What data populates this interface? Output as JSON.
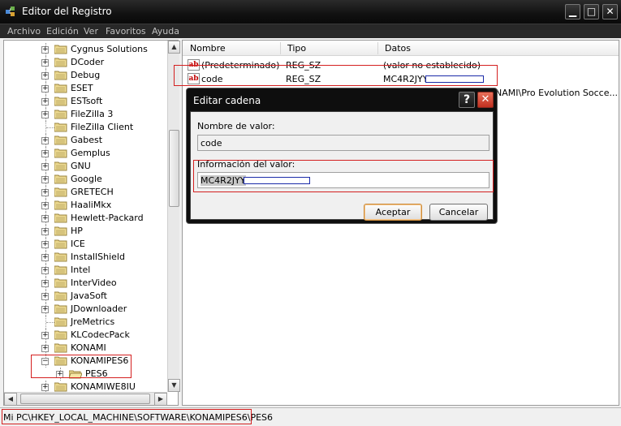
{
  "window": {
    "title": "Editor del Registro",
    "minimize": "▁",
    "maximize": "□",
    "close": "✕"
  },
  "menu": [
    "Archivo",
    "Edición",
    "Ver",
    "Favoritos",
    "Ayuda"
  ],
  "tree": {
    "items": [
      {
        "label": "Cygnus Solutions",
        "expander": "+"
      },
      {
        "label": "DCoder",
        "expander": "+"
      },
      {
        "label": "Debug",
        "expander": "+"
      },
      {
        "label": "ESET",
        "expander": "+"
      },
      {
        "label": "ESTsoft",
        "expander": "+"
      },
      {
        "label": "FileZilla 3",
        "expander": "+"
      },
      {
        "label": "FileZilla Client",
        "expander": ""
      },
      {
        "label": "Gabest",
        "expander": "+"
      },
      {
        "label": "Gemplus",
        "expander": "+"
      },
      {
        "label": "GNU",
        "expander": "+"
      },
      {
        "label": "Google",
        "expander": "+"
      },
      {
        "label": "GRETECH",
        "expander": "+"
      },
      {
        "label": "HaaliMkx",
        "expander": "+"
      },
      {
        "label": "Hewlett-Packard",
        "expander": "+"
      },
      {
        "label": "HP",
        "expander": "+"
      },
      {
        "label": "ICE",
        "expander": "+"
      },
      {
        "label": "InstallShield",
        "expander": "+"
      },
      {
        "label": "Intel",
        "expander": "+"
      },
      {
        "label": "InterVideo",
        "expander": "+"
      },
      {
        "label": "JavaSoft",
        "expander": "+"
      },
      {
        "label": "JDownloader",
        "expander": "+"
      },
      {
        "label": "JreMetrics",
        "expander": ""
      },
      {
        "label": "KLCodecPack",
        "expander": "+"
      },
      {
        "label": "KONAMI",
        "expander": "+"
      },
      {
        "label": "KONAMIPES6",
        "expander": "−"
      },
      {
        "label": "PES6",
        "expander": "+"
      },
      {
        "label": "KONAMIWE8IU",
        "expander": "+"
      }
    ]
  },
  "list": {
    "columns": [
      "Nombre",
      "Tipo",
      "Datos"
    ],
    "rows": [
      {
        "name": "(Predeterminado)",
        "type": "REG_SZ",
        "data": "(valor no establecido)"
      },
      {
        "name": "code",
        "type": "REG_SZ",
        "data": "MC4R2JYY"
      }
    ],
    "partial_data": "NAMI\\Pro Evolution Socce..."
  },
  "dialog": {
    "title": "Editar cadena",
    "help": "?",
    "close": "✕",
    "name_label": "Nombre de valor:",
    "name_value": "code",
    "data_label": "Información del valor:",
    "data_value": "MC4R2JYY",
    "ok": "Aceptar",
    "cancel": "Cancelar"
  },
  "status": {
    "path": "Mi PC\\HKEY_LOCAL_MACHINE\\SOFTWARE\\KONAMIPES6\\PES6"
  },
  "colors": {
    "highlight": "#d42020",
    "redaction": "#1a2aa8"
  }
}
